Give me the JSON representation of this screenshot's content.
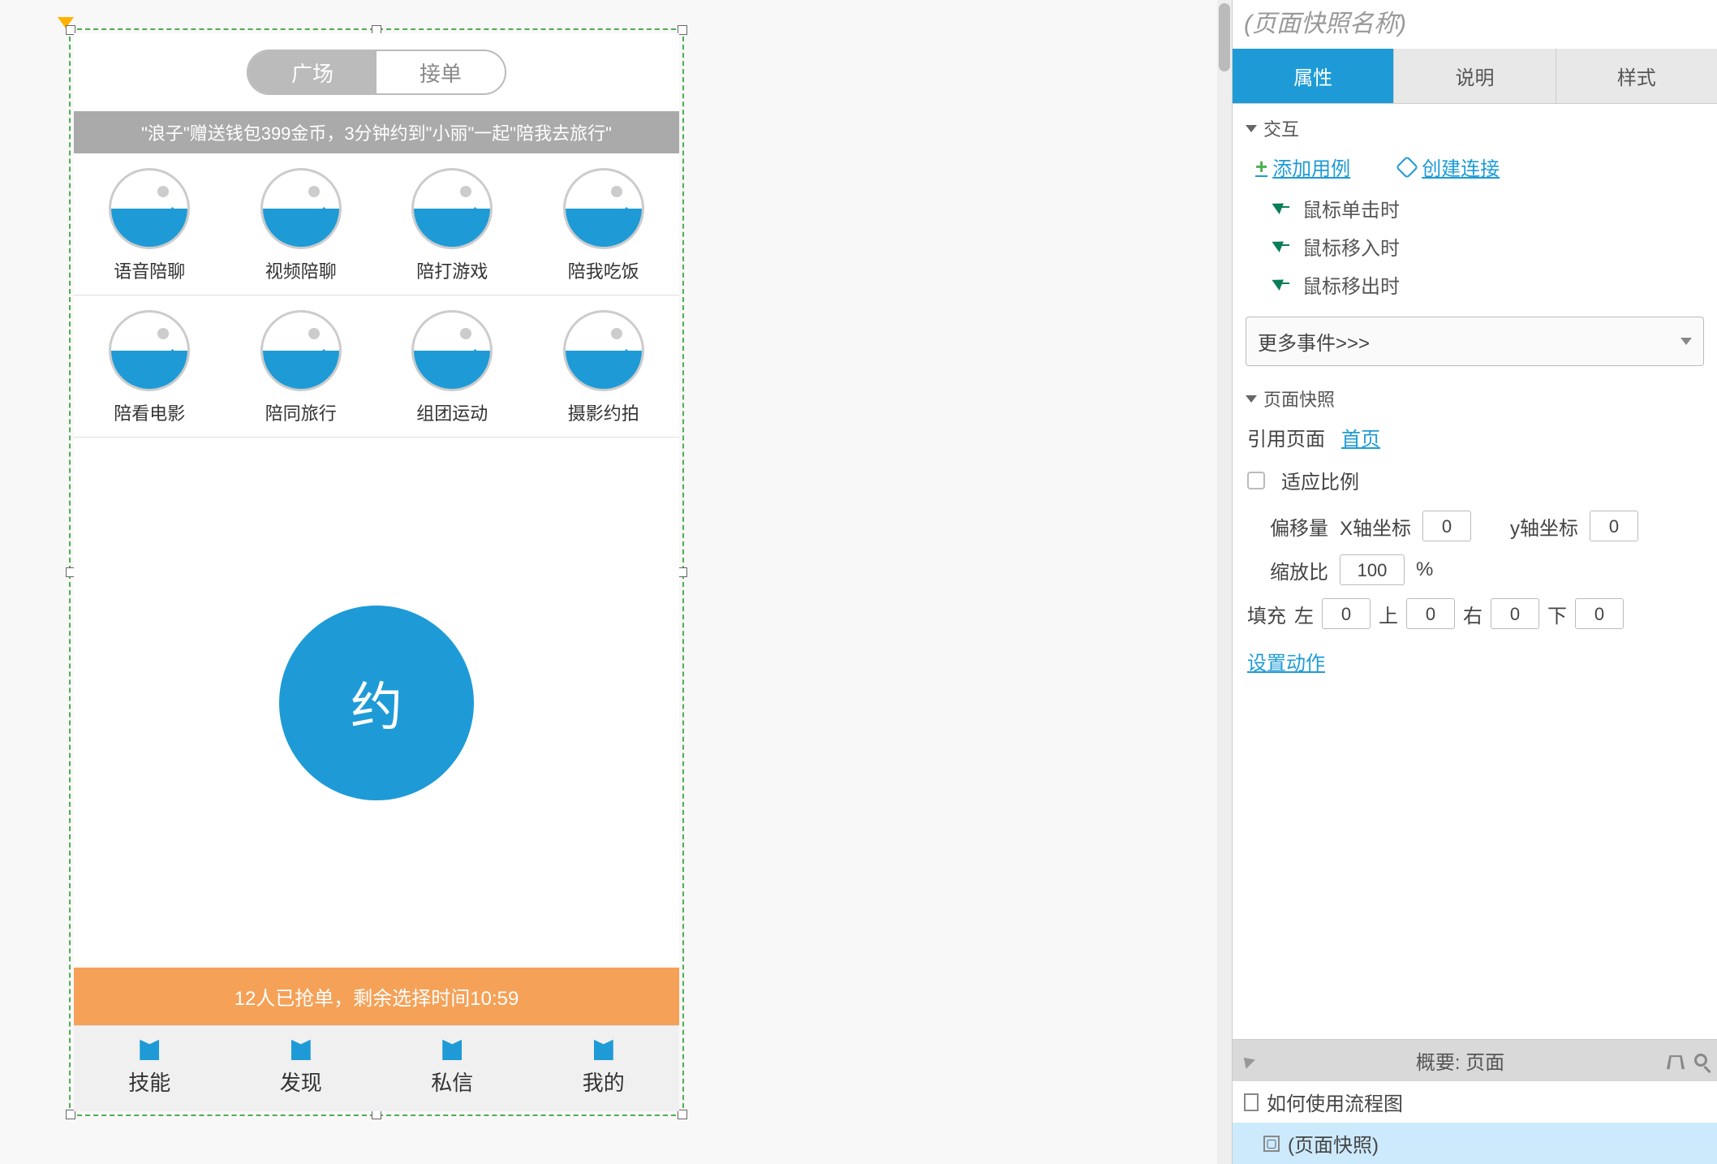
{
  "canvas": {
    "mobile": {
      "segmented": {
        "active": "广场",
        "inactive": "接单"
      },
      "ticker": "\"浪子\"赠送钱包399金币，3分钟约到\"小丽\"一起\"陪我去旅行\"",
      "categories_row1": [
        "语音陪聊",
        "视频陪聊",
        "陪打游戏",
        "陪我吃饭"
      ],
      "categories_row2": [
        "陪看电影",
        "陪同旅行",
        "组团运动",
        "摄影约拍"
      ],
      "big_button": "约",
      "orange_bar": "12人已抢单，剩余选择时间10:59",
      "tabs": [
        "技能",
        "发现",
        "私信",
        "我的"
      ]
    }
  },
  "panel": {
    "widget_name_placeholder": "(页面快照名称)",
    "tabs": {
      "properties": "属性",
      "notes": "说明",
      "style": "样式"
    },
    "interactions": {
      "heading": "交互",
      "add_case": "添加用例",
      "create_link": "创建连接",
      "events": [
        "鼠标单击时",
        "鼠标移入时",
        "鼠标移出时"
      ],
      "more_events": "更多事件>>>"
    },
    "snapshot": {
      "heading": "页面快照",
      "ref_page_label": "引用页面",
      "ref_page_link": "首页",
      "fit_ratio_label": "适应比例",
      "offset_label": "偏移量",
      "x_label": "X轴坐标",
      "y_label": "y轴坐标",
      "x_value": "0",
      "y_value": "0",
      "scale_label": "缩放比",
      "scale_value": "100",
      "scale_unit": "%",
      "padding_label": "填充",
      "pad_left_label": "左",
      "pad_left": "0",
      "pad_top_label": "上",
      "pad_top": "0",
      "pad_right_label": "右",
      "pad_right": "0",
      "pad_bottom_label": "下",
      "pad_bottom": "0",
      "set_action": "设置动作"
    }
  },
  "outline": {
    "title": "概要: 页面",
    "items": [
      {
        "label": "如何使用流程图"
      },
      {
        "label": "(页面快照)"
      }
    ]
  }
}
